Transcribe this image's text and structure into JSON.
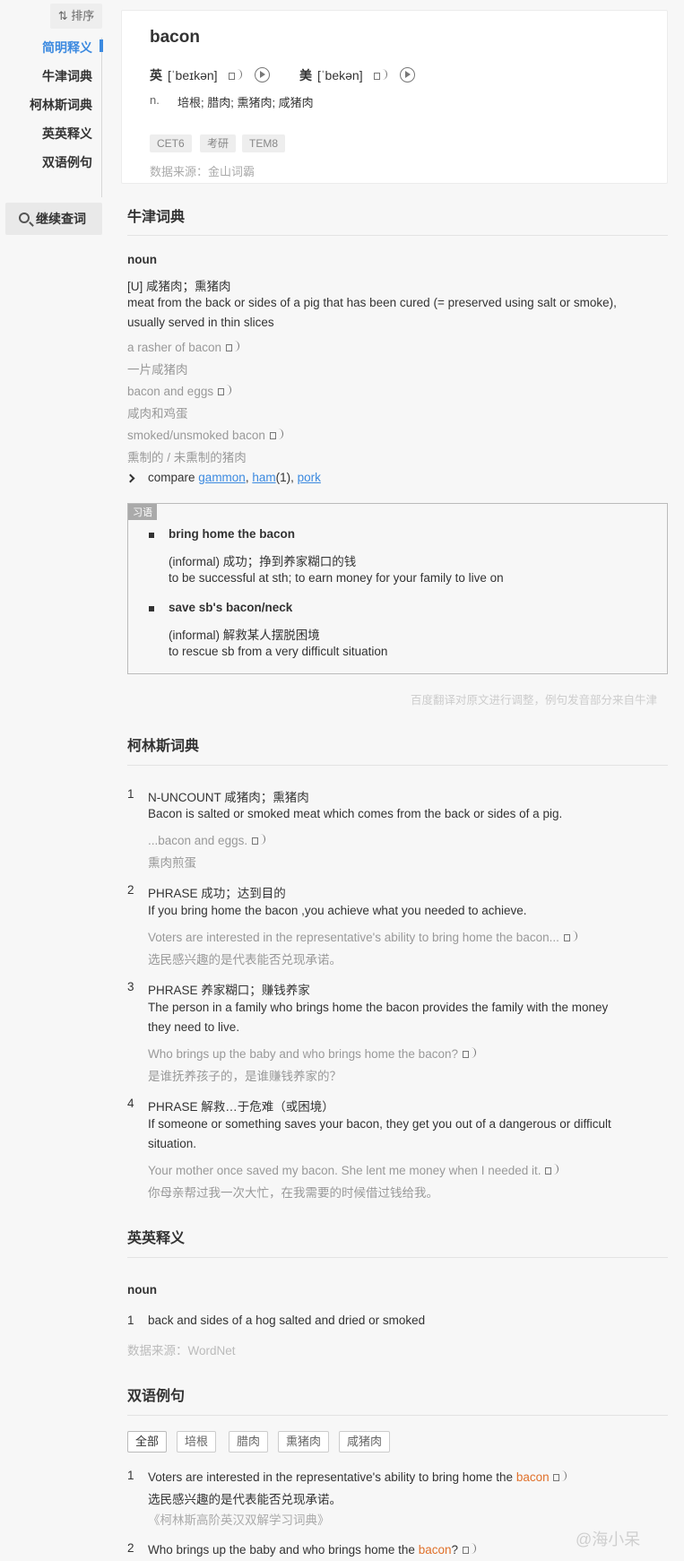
{
  "sidebar": {
    "sort_label": "⇅ 排序",
    "items": [
      {
        "label": "简明释义"
      },
      {
        "label": "牛津词典"
      },
      {
        "label": "柯林斯词典"
      },
      {
        "label": "英英释义"
      },
      {
        "label": "双语例句"
      }
    ],
    "continue_label": "继续查词"
  },
  "card": {
    "word": "bacon",
    "uk_label": "英",
    "uk_ipa": "[ˈbeɪkən]",
    "us_label": "美",
    "us_ipa": "[ˈbekən]",
    "pos": "n.",
    "definition": "培根; 腊肉; 熏猪肉; 咸猪肉",
    "tags": [
      "CET6",
      "考研",
      "TEM8"
    ],
    "source": "数据来源：金山词霸"
  },
  "oxford": {
    "title": "牛津词典",
    "pos": "noun",
    "cn_def": "[U] 咸猪肉；熏猪肉",
    "en_def_1": "meat from the back or sides of a pig that has been cured (= preserved using salt or smoke),",
    "en_def_2": "usually served in thin slices",
    "examples": [
      {
        "en": "a rasher of bacon",
        "cn": "一片咸猪肉"
      },
      {
        "en": "bacon and eggs",
        "cn": "咸肉和鸡蛋"
      },
      {
        "en": "smoked/unsmoked bacon",
        "cn": "熏制的 / 未熏制的猪肉"
      }
    ],
    "compare_label": "compare",
    "compare_links": [
      "gammon",
      "ham",
      "pork"
    ],
    "compare_sep1": ",",
    "compare_ham_suffix": "(1),",
    "idiom_tag": "习语",
    "idioms": [
      {
        "phrase": "bring home the bacon",
        "cn": "(informal) 成功；挣到养家糊口的钱",
        "en": "to be successful at sth; to earn money for your family to live on"
      },
      {
        "phrase": "save sb's bacon/neck",
        "cn": "(informal) 解救某人摆脱困境",
        "en": "to rescue sb from a very difficult situation"
      }
    ],
    "note": "百度翻译对原文进行调整，例句发音部分来自牛津"
  },
  "collins": {
    "title": "柯林斯词典",
    "entries": [
      {
        "num": "1",
        "head": "N-UNCOUNT  咸猪肉；熏猪肉",
        "def": [
          "Bacon is salted or smoked meat which comes from the back or sides of a pig."
        ],
        "ex_en": "...bacon and eggs.",
        "ex_cn": "熏肉煎蛋"
      },
      {
        "num": "2",
        "head": "PHRASE  成功；达到目的",
        "def": [
          "If you bring home the bacon ,you achieve what you needed to achieve."
        ],
        "ex_en": "Voters are interested in the representative's ability to bring home the bacon...",
        "ex_cn": "选民感兴趣的是代表能否兑现承诺。"
      },
      {
        "num": "3",
        "head": "PHRASE  养家糊口；赚钱养家",
        "def": [
          "The person in a family who brings home the bacon provides the family with the money",
          "they need to live."
        ],
        "ex_en": "Who brings up the baby and who brings home the bacon?",
        "ex_cn": "是谁抚养孩子的，是谁赚钱养家的？"
      },
      {
        "num": "4",
        "head": "PHRASE  解救…于危难（或困境）",
        "def": [
          "If someone or something saves your bacon, they get you out of a dangerous or difficult",
          "situation."
        ],
        "ex_en": "Your mother once saved my bacon. She lent me money when I needed it.",
        "ex_cn": "你母亲帮过我一次大忙，在我需要的时候借过钱给我。"
      }
    ]
  },
  "english": {
    "title": "英英释义",
    "pos": "noun",
    "num": "1",
    "def": "back and sides of a hog salted and dried or smoked",
    "source": "数据来源：WordNet"
  },
  "bilingual": {
    "title": "双语例句",
    "filters": [
      "全部",
      "培根",
      "腊肉",
      "熏猪肉",
      "咸猪肉"
    ],
    "examples": [
      {
        "num": "1",
        "en_pre": "Voters are interested in the representative's ability to bring home the",
        "hl": "bacon",
        "en_post": "",
        "cn": "选民感兴趣的是代表能否兑现承诺。",
        "src": "《柯林斯高阶英汉双解学习词典》"
      },
      {
        "num": "2",
        "en_pre": "Who brings up the baby and who brings home the",
        "hl": "bacon",
        "en_post": "?"
      }
    ]
  },
  "watermark": "@海小呆"
}
